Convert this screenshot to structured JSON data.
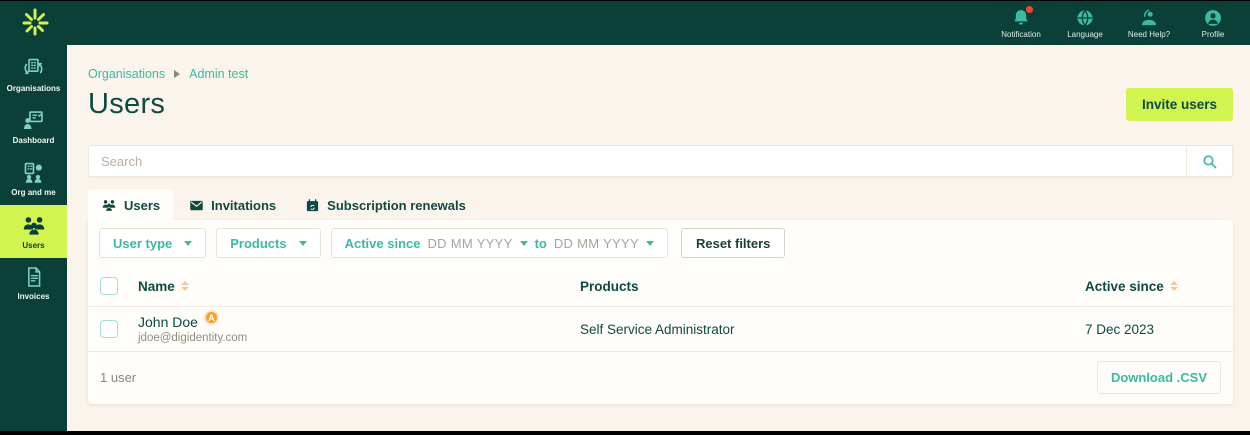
{
  "colors": {
    "brand_dark_green": "#0a4038",
    "accent_teal": "#3cb9a3",
    "accent_lime": "#d2f450",
    "text_dark_green": "#0e4a41",
    "bg_cream": "#faf4ec",
    "card_bg": "#fffdf9",
    "badge_orange": "#f59f2d",
    "notification_red": "#f04438",
    "sort_arrow_sand": "#f2c894"
  },
  "topbar": {
    "actions": [
      {
        "icon": "bell-icon",
        "label": "Notification",
        "has_alert_dot": true
      },
      {
        "icon": "globe-icon",
        "label": "Language",
        "has_alert_dot": false
      },
      {
        "icon": "help-desk-icon",
        "label": "Need Help?",
        "has_alert_dot": false
      },
      {
        "icon": "profile-icon",
        "label": "Profile",
        "has_alert_dot": false
      }
    ]
  },
  "sidebar": {
    "items": [
      {
        "icon": "organisations-icon",
        "label": "Organisations",
        "active": false
      },
      {
        "icon": "dashboard-icon",
        "label": "Dashboard",
        "active": false
      },
      {
        "icon": "org-and-me-icon",
        "label": "Org and me",
        "active": false
      },
      {
        "icon": "users-icon",
        "label": "Users",
        "active": true
      },
      {
        "icon": "invoices-icon",
        "label": "Invoices",
        "active": false
      }
    ]
  },
  "page": {
    "breadcrumb": {
      "parent": "Organisations",
      "current": "Admin test"
    },
    "title": "Users",
    "invite_button_label": "Invite users"
  },
  "search": {
    "placeholder": "Search"
  },
  "tabs": [
    {
      "icon": "users-group-icon",
      "label": "Users",
      "active": true
    },
    {
      "icon": "envelope-icon",
      "label": "Invitations",
      "active": false
    },
    {
      "icon": "calendar-renew-icon",
      "label": "Subscription renewals",
      "active": false
    }
  ],
  "filters": {
    "user_type_label": "User type",
    "products_label": "Products",
    "active_since_label": "Active since",
    "date_from_placeholder": "DD MM YYYY",
    "to_label": "to",
    "date_to_placeholder": "DD MM YYYY",
    "reset_label": "Reset filters"
  },
  "table": {
    "columns": {
      "name": "Name",
      "products": "Products",
      "active_since": "Active since"
    },
    "rows": [
      {
        "name": "John Doe",
        "badge": "A",
        "email": "jdoe@digidentity.com",
        "products": "Self Service Administrator",
        "active_since": "7 Dec 2023"
      }
    ],
    "footer": {
      "count_label": "1 user",
      "download_label": "Download .CSV"
    }
  }
}
